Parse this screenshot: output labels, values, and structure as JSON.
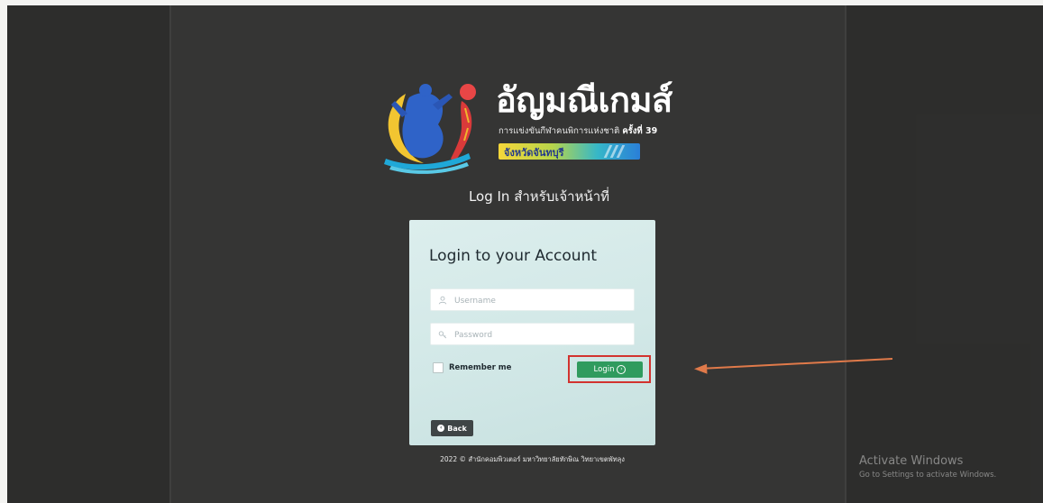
{
  "logo": {
    "title": "อัญมณีเกมส์",
    "subtitle_prefix": "การแข่งขันกีฬาคนพิการแห่งชาติ",
    "subtitle_edition": "ครั้งที่ 39",
    "ribbon_text": "จังหวัดจันทบุรี"
  },
  "page": {
    "heading": "Log In สำหรับเจ้าหน้าที่"
  },
  "login_card": {
    "title": "Login to your Account",
    "username_placeholder": "Username",
    "password_placeholder": "Password",
    "remember_label": "Remember me",
    "login_label": "Login",
    "back_label": "Back"
  },
  "footer": {
    "text": "2022 © สำนักคอมพิวเตอร์ มหาวิทยาลัยทักษิณ วิทยาเขตพัทลุง"
  },
  "watermark": {
    "title": "Activate Windows",
    "subtitle": "Go to Settings to activate Windows."
  },
  "colors": {
    "background": "#353534",
    "card": "#d4e9e8",
    "login_button": "#2f9b5e",
    "highlight_box": "#d2332f",
    "annotation_arrow": "#e07a4a"
  }
}
